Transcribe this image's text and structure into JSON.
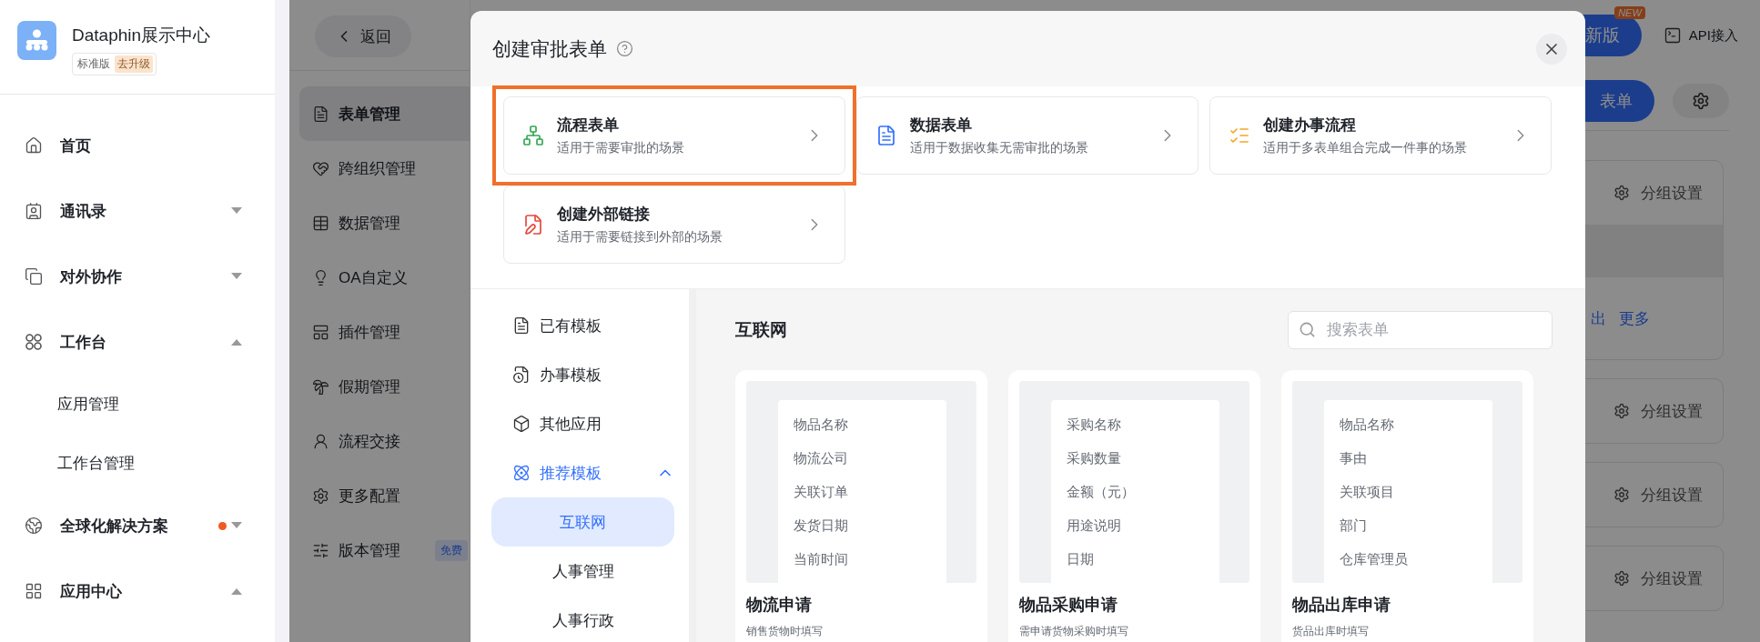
{
  "sidebar": {
    "org_name": "Dataphin展示中心",
    "edition": "标准版",
    "upgrade": "去升级",
    "items": [
      {
        "label": "首页"
      },
      {
        "label": "通讯录",
        "expanded": false
      },
      {
        "label": "对外协作",
        "expanded": false
      },
      {
        "label": "工作台",
        "expanded": true,
        "children": [
          {
            "label": "应用管理"
          },
          {
            "label": "工作台管理"
          }
        ]
      },
      {
        "label": "全球化解决方案",
        "expanded": false,
        "notification": true
      },
      {
        "label": "应用中心",
        "expanded": true
      }
    ]
  },
  "sub_nav": {
    "back": "返回",
    "items": [
      {
        "label": "表单管理",
        "selected": true
      },
      {
        "label": "跨组织管理",
        "selected": false
      },
      {
        "label": "数据管理",
        "selected": false
      },
      {
        "label": "OA自定义",
        "selected": false
      },
      {
        "label": "插件管理",
        "selected": false
      },
      {
        "label": "假期管理",
        "selected": false
      },
      {
        "label": "流程交接",
        "selected": false
      },
      {
        "label": "更多配置",
        "selected": false
      },
      {
        "label": "版本管理",
        "selected": false,
        "badge": "免费"
      }
    ]
  },
  "top_bar": {
    "new_version": "新版",
    "new_badge": "NEW",
    "api": "API接入"
  },
  "toolbar": {
    "create": "表单"
  },
  "groups": [
    {
      "label": "分组设置",
      "links": [
        "出",
        "更多"
      ]
    },
    {
      "label": "分组设置"
    },
    {
      "label": "分组设置"
    },
    {
      "label": "分组设置"
    }
  ],
  "modal": {
    "title": "创建审批表单",
    "form_types": [
      {
        "title": "流程表单",
        "description": "适用于需要审批的场景",
        "highlighted": true
      },
      {
        "title": "数据表单",
        "description": "适用于数据收集无需审批的场景",
        "highlighted": false
      },
      {
        "title": "创建办事流程",
        "description": "适用于多表单组合完成一件事的场景",
        "highlighted": false
      },
      {
        "title": "创建外部链接",
        "description": "适用于需要链接到外部的场景",
        "highlighted": false
      }
    ],
    "template_nav": [
      {
        "label": "已有模板",
        "selected": false
      },
      {
        "label": "办事模板",
        "selected": false
      },
      {
        "label": "其他应用",
        "selected": false
      },
      {
        "label": "推荐模板",
        "selected": true,
        "expanded": true,
        "children": [
          {
            "label": "互联网",
            "selected": true
          },
          {
            "label": "人事管理",
            "selected": false
          },
          {
            "label": "人事行政",
            "selected": false
          }
        ]
      }
    ],
    "category": "互联网",
    "search": {
      "placeholder": "搜索表单"
    },
    "templates": [
      {
        "fields": [
          "物品名称",
          "物流公司",
          "关联订单",
          "发货日期",
          "当前时间"
        ],
        "title": "物流申请",
        "description": "销售货物时填写"
      },
      {
        "fields": [
          "采购名称",
          "采购数量",
          "金额（元）",
          "用途说明",
          "日期"
        ],
        "title": "物品采购申请",
        "description": "需申请货物采购时填写"
      },
      {
        "fields": [
          "物品名称",
          "事由",
          "关联项目",
          "部门",
          "仓库管理员"
        ],
        "title": "物品出库申请",
        "description": "货品出库时填写"
      }
    ]
  }
}
